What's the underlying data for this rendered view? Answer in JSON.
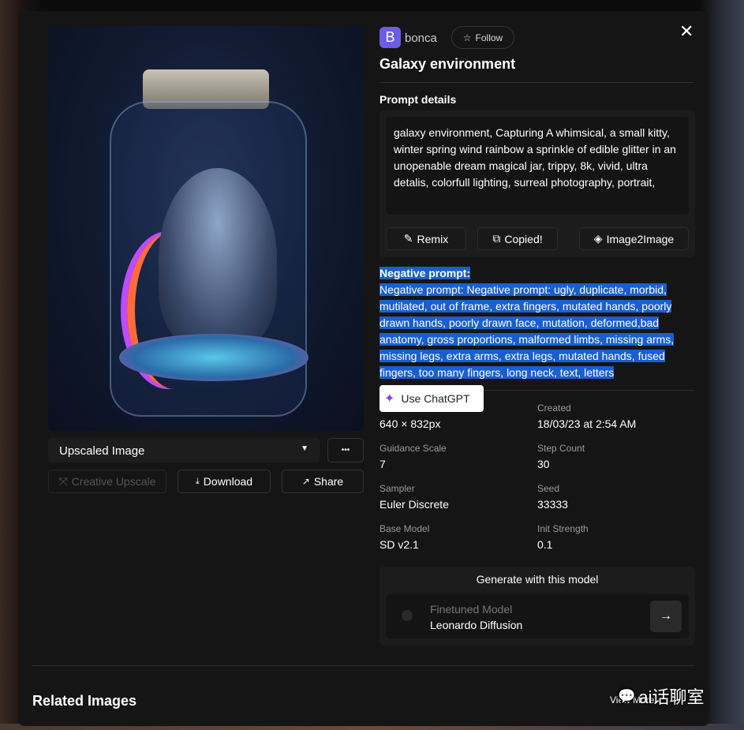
{
  "author": {
    "initial": "B",
    "name": "bonca",
    "follow_label": "Follow"
  },
  "title": "Galaxy environment",
  "prompt": {
    "heading": "Prompt details",
    "text": "galaxy environment, Capturing A whimsical, a small kitty, winter spring wind rainbow a sprinkle of edible glitter in an unopenable dream magical jar, trippy, 8k, vivid, ultra detalis, colorfull lighting, surreal photography, portrait,",
    "actions": [
      "Remix",
      "Copied!",
      "Image2Image"
    ]
  },
  "negative": {
    "heading": "Negative prompt:",
    "text": "Negative prompt: Negative prompt: ugly, duplicate, morbid, mutilated, out of frame, extra fingers, mutated hands, poorly drawn hands, poorly drawn face, mutation, deformed,bad anatomy, gross proportions, malformed limbs, missing arms, missing legs, extra arms, extra legs, mutated hands, fused fingers, too many fingers, long neck, text, letters"
  },
  "chatgpt_label": "Use ChatGPT",
  "details": [
    {
      "label": "",
      "value": "640 × 832px"
    },
    {
      "label": "Created",
      "value": "18/03/23 at 2:54 AM"
    },
    {
      "label": "Guidance Scale",
      "value": "7"
    },
    {
      "label": "Step Count",
      "value": "30"
    },
    {
      "label": "Sampler",
      "value": "Euler Discrete"
    },
    {
      "label": "Seed",
      "value": "33333"
    },
    {
      "label": "Base Model",
      "value": "SD v2.1"
    },
    {
      "label": "Init Strength",
      "value": "0.1"
    }
  ],
  "generate": {
    "heading": "Generate with this model",
    "model_type": "Finetuned Model",
    "model_name": "Leonardo Diffusion"
  },
  "image_controls": {
    "variant": "Upscaled Image",
    "more": "•••",
    "creative_upscale": "Creative Upscale",
    "download": "Download",
    "share": "Share"
  },
  "related": {
    "heading": "Related Images",
    "view_more": "View More"
  },
  "watermark": "ai话聊室"
}
